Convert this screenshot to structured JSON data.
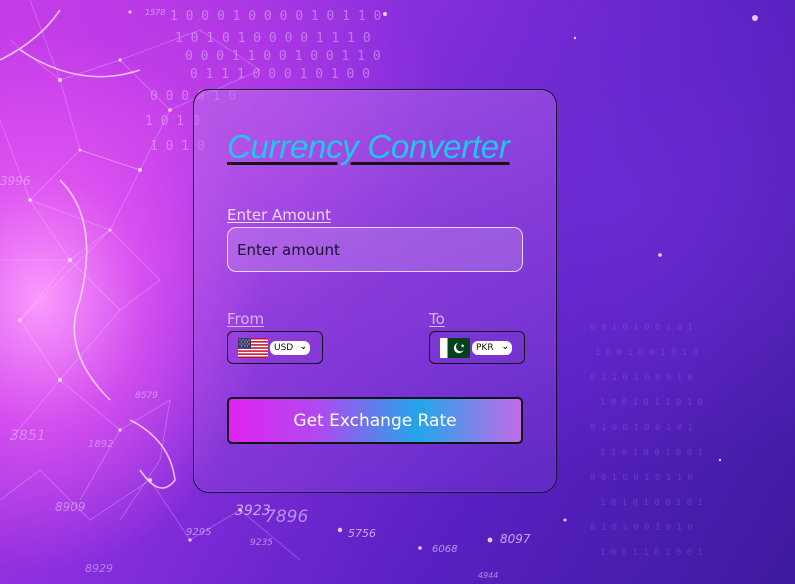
{
  "converter": {
    "title": "Currency Converter",
    "amount_label": "Enter Amount",
    "amount_placeholder": "Enter amount",
    "amount_value": "",
    "from_label": "From",
    "to_label": "To",
    "from_currency": "USD",
    "to_currency": "PKR",
    "from_flag_icon": "us-flag-icon",
    "to_flag_icon": "pk-flag-icon",
    "button_label": "Get Exchange Rate"
  },
  "theme": {
    "title_color": "#1ec8e8",
    "button_gradient_start": "#e024f0",
    "button_gradient_mid": "#22a6ea",
    "background_primary": "#5a21c4",
    "background_glow": "#e05af0"
  },
  "background": {
    "numbers": [
      "3923",
      "7896",
      "5756",
      "8097",
      "6068",
      "9295",
      "8909",
      "9235",
      "4944",
      "3996",
      "1578",
      "3851",
      "1892",
      "8579",
      "8929"
    ]
  }
}
